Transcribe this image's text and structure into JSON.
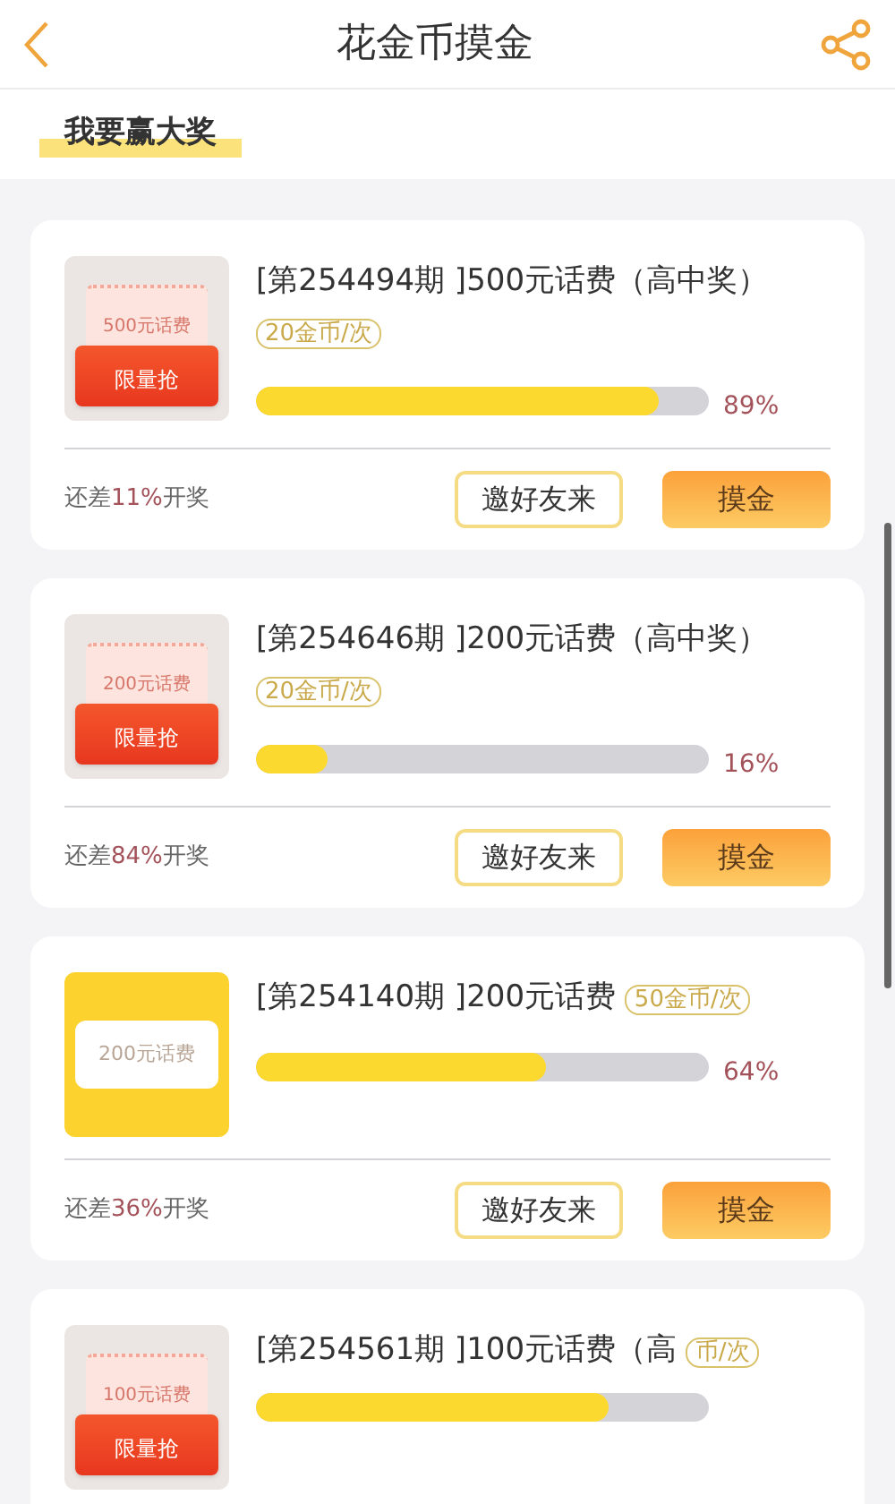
{
  "header": {
    "title": "花金币摸金"
  },
  "section": {
    "title": "我要赢大奖"
  },
  "cards": [
    {
      "kind": "envelope",
      "image_label": "500元话费",
      "image_tag": "限量抢",
      "title": "[第254494期 ]500元话费（高中奖）",
      "badge": "20金币/次",
      "level": 0.89,
      "percent": "89%",
      "remain_prefix": "还差",
      "remain_value": "11%",
      "remain_suffix": "开奖",
      "invite": "邀好友来",
      "action": "摸金"
    },
    {
      "kind": "envelope",
      "image_label": "200元话费",
      "image_tag": "限量抢",
      "title": "[第254646期 ]200元话费（高中奖）",
      "badge": "20金币/次",
      "level": 0.16,
      "percent": "16%",
      "remain_prefix": "还差",
      "remain_value": "84%",
      "remain_suffix": "开奖",
      "invite": "邀好友来",
      "action": "摸金"
    },
    {
      "kind": "ticket",
      "image_label": "200元话费",
      "title": "[第254140期 ]200元话费",
      "badge": "50金币/次",
      "level": 0.64,
      "percent": "64%",
      "remain_prefix": "还差",
      "remain_value": "36%",
      "remain_suffix": "开奖",
      "invite": "邀好友来",
      "action": "摸金"
    },
    {
      "kind": "envelope",
      "image_label": "100元话费",
      "image_tag": "限量抢",
      "title": "[第254561期 ]100元话费（高",
      "badge": "币/次",
      "level": 0.78
    }
  ]
}
